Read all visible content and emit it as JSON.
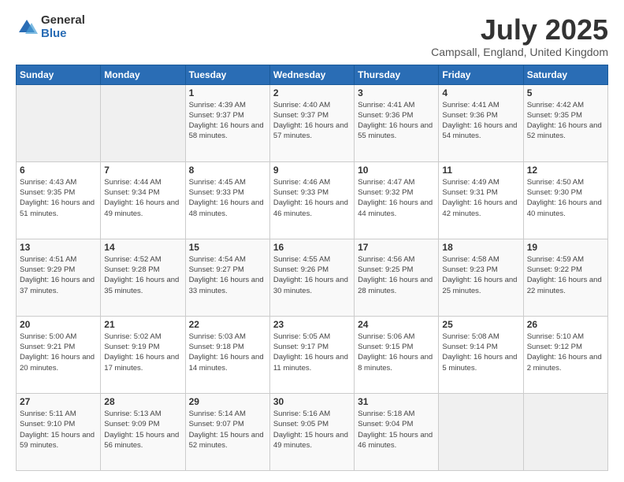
{
  "header": {
    "logo_general": "General",
    "logo_blue": "Blue",
    "title": "July 2025",
    "subtitle": "Campsall, England, United Kingdom"
  },
  "days_of_week": [
    "Sunday",
    "Monday",
    "Tuesday",
    "Wednesday",
    "Thursday",
    "Friday",
    "Saturday"
  ],
  "weeks": [
    [
      {
        "day": "",
        "info": ""
      },
      {
        "day": "",
        "info": ""
      },
      {
        "day": "1",
        "info": "Sunrise: 4:39 AM\nSunset: 9:37 PM\nDaylight: 16 hours and 58 minutes."
      },
      {
        "day": "2",
        "info": "Sunrise: 4:40 AM\nSunset: 9:37 PM\nDaylight: 16 hours and 57 minutes."
      },
      {
        "day": "3",
        "info": "Sunrise: 4:41 AM\nSunset: 9:36 PM\nDaylight: 16 hours and 55 minutes."
      },
      {
        "day": "4",
        "info": "Sunrise: 4:41 AM\nSunset: 9:36 PM\nDaylight: 16 hours and 54 minutes."
      },
      {
        "day": "5",
        "info": "Sunrise: 4:42 AM\nSunset: 9:35 PM\nDaylight: 16 hours and 52 minutes."
      }
    ],
    [
      {
        "day": "6",
        "info": "Sunrise: 4:43 AM\nSunset: 9:35 PM\nDaylight: 16 hours and 51 minutes."
      },
      {
        "day": "7",
        "info": "Sunrise: 4:44 AM\nSunset: 9:34 PM\nDaylight: 16 hours and 49 minutes."
      },
      {
        "day": "8",
        "info": "Sunrise: 4:45 AM\nSunset: 9:33 PM\nDaylight: 16 hours and 48 minutes."
      },
      {
        "day": "9",
        "info": "Sunrise: 4:46 AM\nSunset: 9:33 PM\nDaylight: 16 hours and 46 minutes."
      },
      {
        "day": "10",
        "info": "Sunrise: 4:47 AM\nSunset: 9:32 PM\nDaylight: 16 hours and 44 minutes."
      },
      {
        "day": "11",
        "info": "Sunrise: 4:49 AM\nSunset: 9:31 PM\nDaylight: 16 hours and 42 minutes."
      },
      {
        "day": "12",
        "info": "Sunrise: 4:50 AM\nSunset: 9:30 PM\nDaylight: 16 hours and 40 minutes."
      }
    ],
    [
      {
        "day": "13",
        "info": "Sunrise: 4:51 AM\nSunset: 9:29 PM\nDaylight: 16 hours and 37 minutes."
      },
      {
        "day": "14",
        "info": "Sunrise: 4:52 AM\nSunset: 9:28 PM\nDaylight: 16 hours and 35 minutes."
      },
      {
        "day": "15",
        "info": "Sunrise: 4:54 AM\nSunset: 9:27 PM\nDaylight: 16 hours and 33 minutes."
      },
      {
        "day": "16",
        "info": "Sunrise: 4:55 AM\nSunset: 9:26 PM\nDaylight: 16 hours and 30 minutes."
      },
      {
        "day": "17",
        "info": "Sunrise: 4:56 AM\nSunset: 9:25 PM\nDaylight: 16 hours and 28 minutes."
      },
      {
        "day": "18",
        "info": "Sunrise: 4:58 AM\nSunset: 9:23 PM\nDaylight: 16 hours and 25 minutes."
      },
      {
        "day": "19",
        "info": "Sunrise: 4:59 AM\nSunset: 9:22 PM\nDaylight: 16 hours and 22 minutes."
      }
    ],
    [
      {
        "day": "20",
        "info": "Sunrise: 5:00 AM\nSunset: 9:21 PM\nDaylight: 16 hours and 20 minutes."
      },
      {
        "day": "21",
        "info": "Sunrise: 5:02 AM\nSunset: 9:19 PM\nDaylight: 16 hours and 17 minutes."
      },
      {
        "day": "22",
        "info": "Sunrise: 5:03 AM\nSunset: 9:18 PM\nDaylight: 16 hours and 14 minutes."
      },
      {
        "day": "23",
        "info": "Sunrise: 5:05 AM\nSunset: 9:17 PM\nDaylight: 16 hours and 11 minutes."
      },
      {
        "day": "24",
        "info": "Sunrise: 5:06 AM\nSunset: 9:15 PM\nDaylight: 16 hours and 8 minutes."
      },
      {
        "day": "25",
        "info": "Sunrise: 5:08 AM\nSunset: 9:14 PM\nDaylight: 16 hours and 5 minutes."
      },
      {
        "day": "26",
        "info": "Sunrise: 5:10 AM\nSunset: 9:12 PM\nDaylight: 16 hours and 2 minutes."
      }
    ],
    [
      {
        "day": "27",
        "info": "Sunrise: 5:11 AM\nSunset: 9:10 PM\nDaylight: 15 hours and 59 minutes."
      },
      {
        "day": "28",
        "info": "Sunrise: 5:13 AM\nSunset: 9:09 PM\nDaylight: 15 hours and 56 minutes."
      },
      {
        "day": "29",
        "info": "Sunrise: 5:14 AM\nSunset: 9:07 PM\nDaylight: 15 hours and 52 minutes."
      },
      {
        "day": "30",
        "info": "Sunrise: 5:16 AM\nSunset: 9:05 PM\nDaylight: 15 hours and 49 minutes."
      },
      {
        "day": "31",
        "info": "Sunrise: 5:18 AM\nSunset: 9:04 PM\nDaylight: 15 hours and 46 minutes."
      },
      {
        "day": "",
        "info": ""
      },
      {
        "day": "",
        "info": ""
      }
    ]
  ]
}
